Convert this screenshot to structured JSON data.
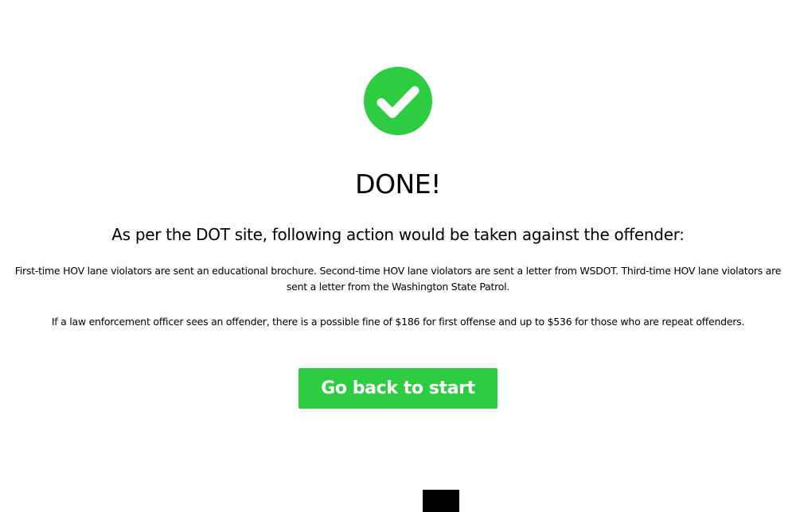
{
  "status": {
    "icon": "check-circle-icon",
    "icon_color": "#2ecc40",
    "title": "DONE!"
  },
  "content": {
    "subtitle": "As per the DOT site, following action would be taken against the offender:",
    "paragraph_1": "First-time HOV lane violators are sent an educational brochure. Second-time HOV lane violators are sent a letter from WSDOT. Third-time HOV lane violators are sent a letter from the Washington State Patrol.",
    "paragraph_2": "If a law enforcement officer sees an offender, there is a possible fine of $186 for first offense and up to $536 for those who are repeat offenders."
  },
  "actions": {
    "back_label": "Go back to start",
    "button_color": "#2ecc40"
  }
}
